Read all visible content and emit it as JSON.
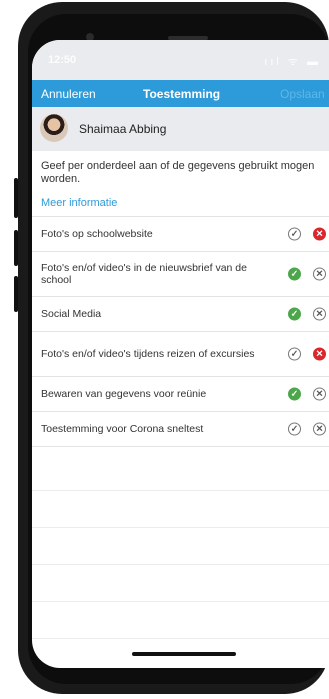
{
  "status_bar": {
    "time": "12:50",
    "icons": "ııl ᯤ ▬"
  },
  "nav": {
    "cancel": "Annuleren",
    "title": "Toestemming",
    "save": "Opslaan"
  },
  "profile": {
    "name": "Shaimaa Abbing"
  },
  "intro": {
    "text": "Geef per onderdeel aan of de gegevens gebruikt mogen worden.",
    "more_info": "Meer informatie"
  },
  "consents": [
    {
      "label": "Foto's op schoolwebsite",
      "yes_icon": "check-icon",
      "no_icon": "cross-icon",
      "selected": "no"
    },
    {
      "label": "Foto's en/of video's in de nieuwsbrief van de school",
      "yes_icon": "check-icon",
      "no_icon": "cross-icon",
      "selected": "yes"
    },
    {
      "label": "Social Media",
      "yes_icon": "check-icon",
      "no_icon": "cross-icon",
      "selected": "yes"
    },
    {
      "label": "Foto's en/of video's tijdens reizen of excursies",
      "yes_icon": "check-icon",
      "no_icon": "cross-icon",
      "selected": "no"
    },
    {
      "label": "Bewaren van gegevens voor reünie",
      "yes_icon": "check-icon",
      "no_icon": "cross-icon",
      "selected": "yes"
    },
    {
      "label": "Toestemming voor Corona sneltest",
      "yes_icon": "check-icon",
      "no_icon": "cross-icon",
      "selected": "none"
    }
  ],
  "colors": {
    "accent": "#2d9bd9",
    "yes": "#4ca64c",
    "no": "#d9272e"
  }
}
